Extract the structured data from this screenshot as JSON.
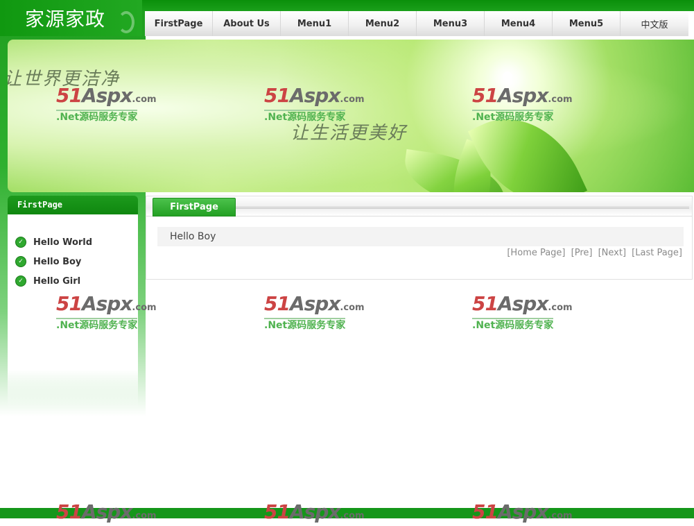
{
  "brand": {
    "title": "家源家政"
  },
  "nav": {
    "items": [
      "FirstPage",
      "About Us",
      "Menu1",
      "Menu2",
      "Menu3",
      "Menu4",
      "Menu5",
      "中文版"
    ]
  },
  "banner": {
    "slogan_1": "让世界更洁净",
    "slogan_2": "让生活更美好"
  },
  "watermark": {
    "logo_num": "51",
    "logo_word": "Aspx",
    "logo_suffix": ".com",
    "subtitle": ".Net源码服务专家"
  },
  "sidebar": {
    "title": "FirstPage",
    "items": [
      "Hello World",
      "Hello Boy",
      "Hello Girl"
    ]
  },
  "main": {
    "tab_label": "FirstPage",
    "content": "Hello Boy",
    "pager": [
      "[Home Page]",
      "[Pre]",
      "[Next]",
      "[Last Page]"
    ]
  },
  "colors": {
    "brand_green": "#1aa01a",
    "tab_green": "#23a023",
    "watermark_red": "#cc4444",
    "watermark_green": "#4fb24f"
  }
}
